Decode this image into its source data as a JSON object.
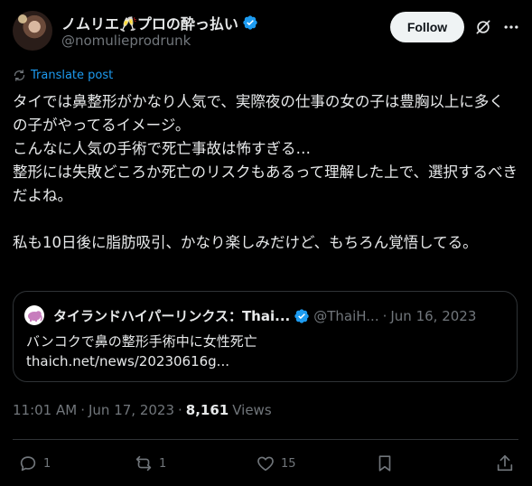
{
  "author": {
    "display_name": "ノムリエ🥂プロの酔っ払い",
    "handle": "@nomulieprodrunk"
  },
  "header": {
    "follow_label": "Follow"
  },
  "translate_label": "Translate post",
  "post_text": "タイでは鼻整形がかなり人気で、実際夜の仕事の女の子は豊胸以上に多くの子がやってるイメージ。\nこんなに人気の手術で死亡事故は怖すぎる…\n整形には失敗どころか死亡のリスクもあるって理解した上で、選択するべきだよね。\n\n私も10日後に脂肪吸引、かなり楽しみだけど、もちろん覚悟してる。",
  "quote": {
    "name": "タイランドハイパーリンクス：Thai...",
    "handle": "@ThaiH...",
    "separator": "·",
    "date": "Jun 16, 2023",
    "text_line1": "バンコクで鼻の整形手術中に女性死亡",
    "text_line2": "thaich.net/news/20230616g..."
  },
  "meta": {
    "time": "11:01 AM",
    "separator": "·",
    "date": "Jun 17, 2023",
    "separator2": "·",
    "views_count": "8,161",
    "views_label": "Views"
  },
  "actions": {
    "replies": "1",
    "reposts": "1",
    "likes": "15"
  },
  "colors": {
    "background": "#000000",
    "text": "#e7e9ea",
    "muted": "#71767b",
    "accent": "#1d9bf0",
    "border": "#2f3336"
  }
}
